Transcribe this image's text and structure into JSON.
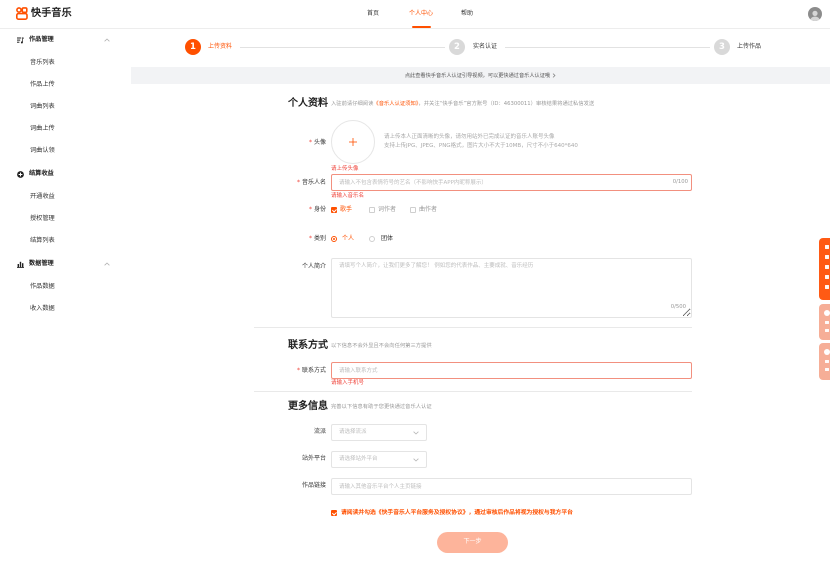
{
  "header": {
    "logo_text": "快手音乐",
    "nav": [
      {
        "label": "首页",
        "active": false
      },
      {
        "label": "个人中心",
        "active": true
      },
      {
        "label": "帮助",
        "active": false
      }
    ]
  },
  "sidebar": {
    "sections": [
      {
        "title": "作品管理",
        "icon": "music-library-icon",
        "expanded": true,
        "items": [
          "音乐列表",
          "作品上传",
          "词曲列表",
          "词曲上传",
          "词曲认领"
        ]
      },
      {
        "title": "结算收益",
        "icon": "income-icon",
        "expanded": true,
        "items": [
          "开通收益",
          "授权管理",
          "结算列表"
        ]
      },
      {
        "title": "数据管理",
        "icon": "bar-chart-icon",
        "expanded": true,
        "items": [
          "作品数据",
          "收入数据"
        ]
      }
    ]
  },
  "steps": [
    {
      "number": "1",
      "label": "上传资料",
      "active": true
    },
    {
      "number": "2",
      "label": "实名认证",
      "active": false
    },
    {
      "number": "3",
      "label": "上传作品",
      "active": false
    }
  ],
  "notice": {
    "text": "点此查看快手音乐人认证引导视频，可以更快通过音乐人认证哦"
  },
  "required_mark": "*",
  "profile": {
    "title": "个人资料",
    "note_prefix": "入驻前请仔细阅读",
    "note_link": "《音乐人认证须知》",
    "note_suffix": "，并关注“快手音乐”官方账号（ID：46300011）审核结果将通过私信发送",
    "avatar": {
      "label": "头像",
      "hint_1": "请上传本人正面清晰的头像，请勿用站外已完成认证的音乐人账号头像",
      "hint_2": "支持上传JPG、JPEG、PNG格式，图片大小不大于10MB，尺寸不小于640*640",
      "error": "请上传头像"
    },
    "name": {
      "label": "音乐人名",
      "value": "",
      "placeholder": "请输入不包含表情符号的艺名（不影响快手APP内昵称展示）",
      "counter": "0/100",
      "error": "请输入音乐名"
    },
    "identity": {
      "label": "身份",
      "options": [
        {
          "label": "歌手",
          "checked": true
        },
        {
          "label": "词作者",
          "checked": false
        },
        {
          "label": "曲作者",
          "checked": false
        }
      ]
    },
    "category": {
      "label": "类别",
      "options": [
        {
          "label": "个人",
          "selected": true
        },
        {
          "label": "团体",
          "selected": false
        }
      ]
    },
    "intro": {
      "label": "个人简介",
      "value": "",
      "placeholder": "请填写个人简介，让我们更多了解您！\n例如您的代表作品、主要成就、音乐经历",
      "counter": "0/500"
    }
  },
  "contact": {
    "title": "联系方式",
    "note": "以下信息不会外显且不会向任何第三方提供",
    "field": {
      "label": "联系方式",
      "value": "",
      "placeholder": "请输入联系方式",
      "error": "请输入手机号"
    }
  },
  "more": {
    "title": "更多信息",
    "note": "完善以下信息有助于您更快通过音乐人认证",
    "genre": {
      "label": "流派",
      "placeholder": "请选择流派"
    },
    "platform": {
      "label": "站外平台",
      "placeholder": "请选择站外平台"
    },
    "link": {
      "label": "作品链接",
      "value": "",
      "placeholder": "请输入其他音乐平台个人主页链接"
    }
  },
  "agreement": {
    "checked": true,
    "text_prefix": "请阅读并勾选",
    "link": "《快手音乐人平台服务及授权协议》",
    "text_suffix": "，通过审核后作品将视为授权与我方平台"
  },
  "next_button": {
    "label": "下一步",
    "enabled": false
  },
  "colors": {
    "accent": "#ff5000",
    "error": "#f0433a",
    "button_disabled": "#fdb49b",
    "notice_bg": "#f2f3f5",
    "side_tab": "#ff5a14",
    "side_tab_faded": "#f6ae97"
  }
}
